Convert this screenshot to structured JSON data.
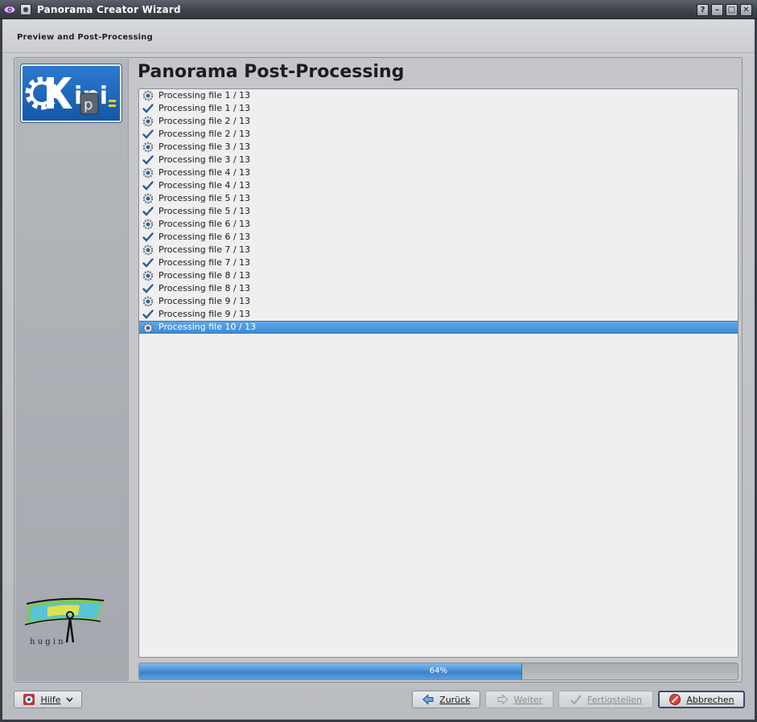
{
  "window": {
    "title": "Panorama Creator Wizard",
    "controls": {
      "help": "?",
      "minimize": "–",
      "maximize": "□",
      "close": "✕"
    }
  },
  "page": {
    "heading": "Preview and Post-Processing",
    "content_title": "Panorama Post-Processing"
  },
  "log": {
    "items": [
      {
        "text": "Processing file 1 / 13",
        "icon": "gear-icon",
        "state": "running"
      },
      {
        "text": "Processing file 1 / 13",
        "icon": "check-icon",
        "state": "done"
      },
      {
        "text": "Processing file 2 / 13",
        "icon": "gear-icon",
        "state": "running"
      },
      {
        "text": "Processing file 2 / 13",
        "icon": "check-icon",
        "state": "done"
      },
      {
        "text": "Processing file 3 / 13",
        "icon": "gear-icon",
        "state": "running"
      },
      {
        "text": "Processing file 3 / 13",
        "icon": "check-icon",
        "state": "done"
      },
      {
        "text": "Processing file 4 / 13",
        "icon": "gear-icon",
        "state": "running"
      },
      {
        "text": "Processing file 4 / 13",
        "icon": "check-icon",
        "state": "done"
      },
      {
        "text": "Processing file 5 / 13",
        "icon": "gear-icon",
        "state": "running"
      },
      {
        "text": "Processing file 5 / 13",
        "icon": "check-icon",
        "state": "done"
      },
      {
        "text": "Processing file 6 / 13",
        "icon": "gear-icon",
        "state": "running"
      },
      {
        "text": "Processing file 6 / 13",
        "icon": "check-icon",
        "state": "done"
      },
      {
        "text": "Processing file 7 / 13",
        "icon": "gear-icon",
        "state": "running"
      },
      {
        "text": "Processing file 7 / 13",
        "icon": "check-icon",
        "state": "done"
      },
      {
        "text": "Processing file 8 / 13",
        "icon": "gear-icon",
        "state": "running"
      },
      {
        "text": "Processing file 8 / 13",
        "icon": "check-icon",
        "state": "done"
      },
      {
        "text": "Processing file 9 / 13",
        "icon": "gear-icon",
        "state": "running"
      },
      {
        "text": "Processing file 9 / 13",
        "icon": "check-icon",
        "state": "done"
      },
      {
        "text": "Processing file 10 / 13",
        "icon": "gear-icon",
        "state": "running",
        "selected": true
      }
    ]
  },
  "progress": {
    "value": 0.64,
    "label": "64%"
  },
  "buttons": {
    "help": "Hilfe",
    "back": "Zurück",
    "next": "Weiter",
    "finish": "Fertigstellen",
    "cancel": "Abbrechen"
  },
  "logos": {
    "kipi": "Kipi",
    "hugin": "h u g i n"
  },
  "colors": {
    "selection": "#3d8ad6",
    "progress_fill": "#4a93d9",
    "logo_blue": "#1f6cc3"
  }
}
